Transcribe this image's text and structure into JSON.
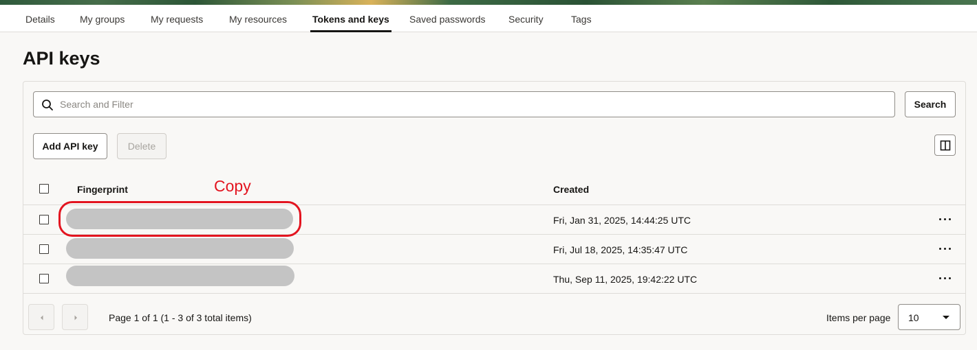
{
  "tabs": [
    {
      "label": "Details",
      "active": false
    },
    {
      "label": "My groups",
      "active": false
    },
    {
      "label": "My requests",
      "active": false
    },
    {
      "label": "My resources",
      "active": false
    },
    {
      "label": "Tokens and keys",
      "active": true
    },
    {
      "label": "Saved passwords",
      "active": false
    },
    {
      "label": "Security",
      "active": false
    },
    {
      "label": "Tags",
      "active": false
    }
  ],
  "page": {
    "title": "API keys"
  },
  "search": {
    "placeholder": "Search and Filter",
    "button_label": "Search",
    "icon": "search-icon"
  },
  "toolbar": {
    "add_label": "Add API key",
    "delete_label": "Delete",
    "columns_icon": "column-layout-icon"
  },
  "table": {
    "columns": [
      "Fingerprint",
      "Created"
    ],
    "rows": [
      {
        "fingerprint": "",
        "created": "Fri, Jan 31, 2025, 14:44:25 UTC"
      },
      {
        "fingerprint": "",
        "created": "Fri, Jul 18, 2025, 14:35:47 UTC"
      },
      {
        "fingerprint": "",
        "created": "Thu, Sep 11, 2025, 19:42:22 UTC"
      }
    ],
    "row_action_icon": "more-actions-icon"
  },
  "annotation": {
    "label": "Copy",
    "color": "#e3141f"
  },
  "pagination": {
    "info": "Page 1 of 1 (1 - 3 of 3 total items)",
    "items_per_page_label": "Items per page",
    "items_per_page_value": "10"
  },
  "colors": {
    "text": "#161513",
    "border": "#dedcd8",
    "redacted": "#c4c4c4",
    "annotation": "#e3141f"
  }
}
